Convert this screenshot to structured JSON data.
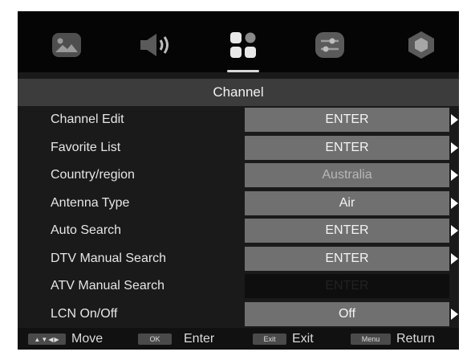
{
  "tabs": [
    {
      "icon": "picture-icon"
    },
    {
      "icon": "sound-icon"
    },
    {
      "icon": "channel-icon",
      "selected": true
    },
    {
      "icon": "settings-sliders-icon"
    },
    {
      "icon": "lock-hexagon-icon"
    }
  ],
  "menu": {
    "title": "Channel",
    "rows": [
      {
        "label": "Channel Edit",
        "value": "ENTER",
        "state": "normal"
      },
      {
        "label": "Favorite List",
        "value": "ENTER",
        "state": "normal"
      },
      {
        "label": "Country/region",
        "value": "Australia",
        "state": "dim"
      },
      {
        "label": "Antenna Type",
        "value": "Air",
        "state": "normal"
      },
      {
        "label": "Auto Search",
        "value": "ENTER",
        "state": "normal"
      },
      {
        "label": "DTV Manual Search",
        "value": "ENTER",
        "state": "normal"
      },
      {
        "label": "ATV Manual Search",
        "value": "ENTER",
        "state": "disabled"
      },
      {
        "label": "LCN On/Off",
        "value": "Off",
        "state": "normal"
      }
    ]
  },
  "footer": {
    "move_key": "▲▼◀▶",
    "move_label": "Move",
    "ok_key": "OK",
    "ok_label": "Enter",
    "exit_key": "Exit",
    "exit_label": "Exit",
    "menu_key": "Menu",
    "menu_label": "Return"
  },
  "colors": {
    "background": "#1a1a1a",
    "value_box": "#707070",
    "title_bar": "#3c3c3c",
    "disabled_box": "#0e0e0e"
  }
}
